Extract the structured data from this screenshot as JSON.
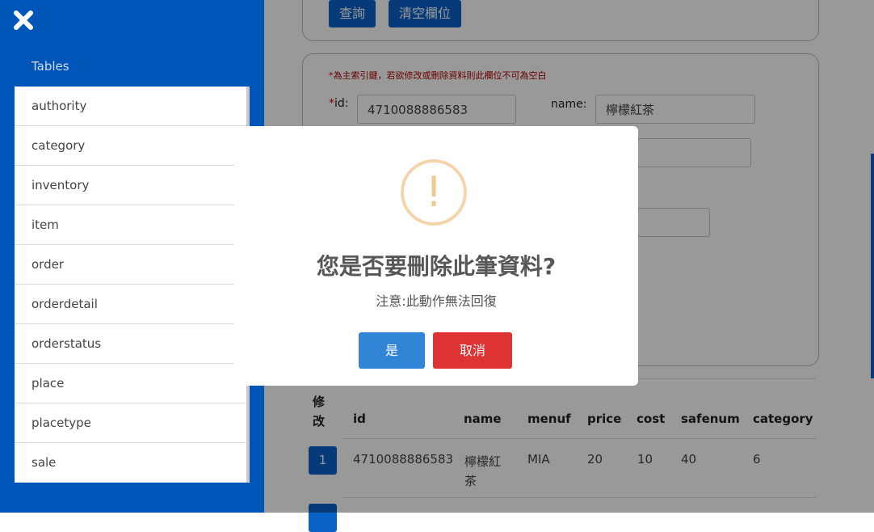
{
  "sidebar": {
    "title": "Tables",
    "items": [
      "authority",
      "category",
      "inventory",
      "item",
      "order",
      "orderdetail",
      "orderstatus",
      "place",
      "placetype",
      "sale"
    ]
  },
  "toolbar": {
    "query_label": "查詢",
    "clear_label": "清空欄位"
  },
  "form": {
    "note": "*為主索引鍵，若欲修改或刪除資料則此欄位不可為空白",
    "id_label": "id:",
    "id_value": "4710088886583",
    "name_label": "name:",
    "name_value": "檸檬紅茶"
  },
  "table": {
    "headers": [
      "修改",
      "id",
      "name",
      "menuf",
      "price",
      "cost",
      "safenum",
      "category"
    ],
    "rows": [
      {
        "button": "1",
        "id": "4710088886583",
        "name": "檸檬紅茶",
        "menuf": "MIA",
        "price": "20",
        "cost": "10",
        "safenum": "40",
        "category": "6"
      }
    ]
  },
  "dialog": {
    "icon": "exclamation-icon",
    "icon_glyph": "!",
    "title": "您是否要刪除此筆資料?",
    "text": "注意:此動作無法回復",
    "confirm_label": "是",
    "cancel_label": "取消"
  },
  "colors": {
    "sidebar_bg": "#0055b8",
    "primary_button": "#0a61c8",
    "confirm_button": "#3085d6",
    "cancel_button": "#dd3333",
    "warning_icon": "#f0c892"
  }
}
